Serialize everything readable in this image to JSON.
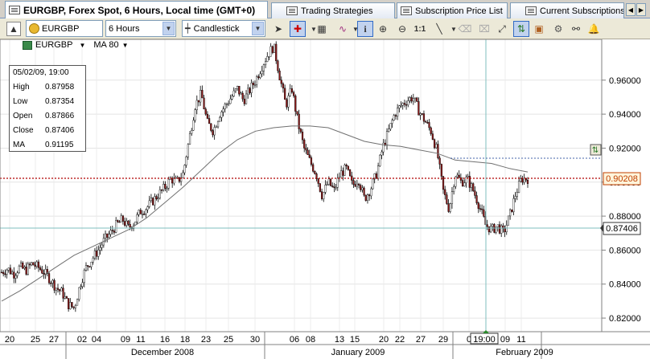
{
  "tabs": [
    {
      "label": "EURGBP, Forex Spot, 6 Hours, Local time (GMT+0)",
      "active": true
    },
    {
      "label": "Trading Strategies",
      "active": false
    },
    {
      "label": "Subscription Price List",
      "active": false
    },
    {
      "label": "Current Subscriptions",
      "active": false
    }
  ],
  "toolbar": {
    "symbol": "EURGBP",
    "interval": "6 Hours",
    "chart_type": "Candlestick"
  },
  "legend": {
    "symbol": "EURGBP",
    "indicator": "MA 80"
  },
  "info": {
    "datetime": "05/02/09, 19:00",
    "rows": [
      {
        "label": "High",
        "value": "0.87958"
      },
      {
        "label": "Low",
        "value": "0.87354"
      },
      {
        "label": "Open",
        "value": "0.87866"
      },
      {
        "label": "Close",
        "value": "0.87406"
      },
      {
        "label": "MA",
        "value": "0.91195"
      }
    ]
  },
  "current_price": "0.90208",
  "cursor_price": "0.87406",
  "cursor_time": "19:00",
  "chart_data": {
    "type": "candlestick",
    "y_ticks": [
      "0.82000",
      "0.84000",
      "0.86000",
      "0.88000",
      "0.90000",
      "0.92000",
      "0.94000",
      "0.96000"
    ],
    "ylim": [
      0.812,
      0.984
    ],
    "day_labels": [
      "20",
      "25",
      "27",
      "02",
      "04",
      "09",
      "11",
      "16",
      "18",
      "23",
      "25",
      "30",
      "06",
      "08",
      "13",
      "15",
      "20",
      "22",
      "27",
      "29",
      "0",
      "09",
      "11"
    ],
    "month_labels": [
      "December 2008",
      "January 2009",
      "February 2009"
    ],
    "close_path": [
      0.847,
      0.849,
      0.846,
      0.85,
      0.848,
      0.852,
      0.85,
      0.847,
      0.843,
      0.838,
      0.835,
      0.828,
      0.826,
      0.84,
      0.85,
      0.855,
      0.86,
      0.866,
      0.87,
      0.875,
      0.878,
      0.873,
      0.877,
      0.883,
      0.885,
      0.889,
      0.893,
      0.897,
      0.902,
      0.9,
      0.905,
      0.925,
      0.945,
      0.952,
      0.935,
      0.93,
      0.94,
      0.945,
      0.95,
      0.955,
      0.948,
      0.954,
      0.96,
      0.968,
      0.975,
      0.98,
      0.962,
      0.945,
      0.955,
      0.935,
      0.92,
      0.912,
      0.905,
      0.892,
      0.9,
      0.895,
      0.905,
      0.908,
      0.898,
      0.902,
      0.89,
      0.896,
      0.905,
      0.92,
      0.93,
      0.94,
      0.945,
      0.948,
      0.95,
      0.942,
      0.936,
      0.93,
      0.918,
      0.895,
      0.884,
      0.905,
      0.9,
      0.902,
      0.895,
      0.886,
      0.875,
      0.872,
      0.874,
      0.87,
      0.88,
      0.893,
      0.902,
      0.902
    ],
    "ma": [
      0.83,
      0.836,
      0.843,
      0.85,
      0.857,
      0.862,
      0.867,
      0.872,
      0.879,
      0.888,
      0.897,
      0.907,
      0.917,
      0.925,
      0.93,
      0.932,
      0.933,
      0.933,
      0.932,
      0.928,
      0.924,
      0.922,
      0.921,
      0.919,
      0.917,
      0.913,
      0.912,
      0.911,
      0.908,
      0.906
    ]
  }
}
